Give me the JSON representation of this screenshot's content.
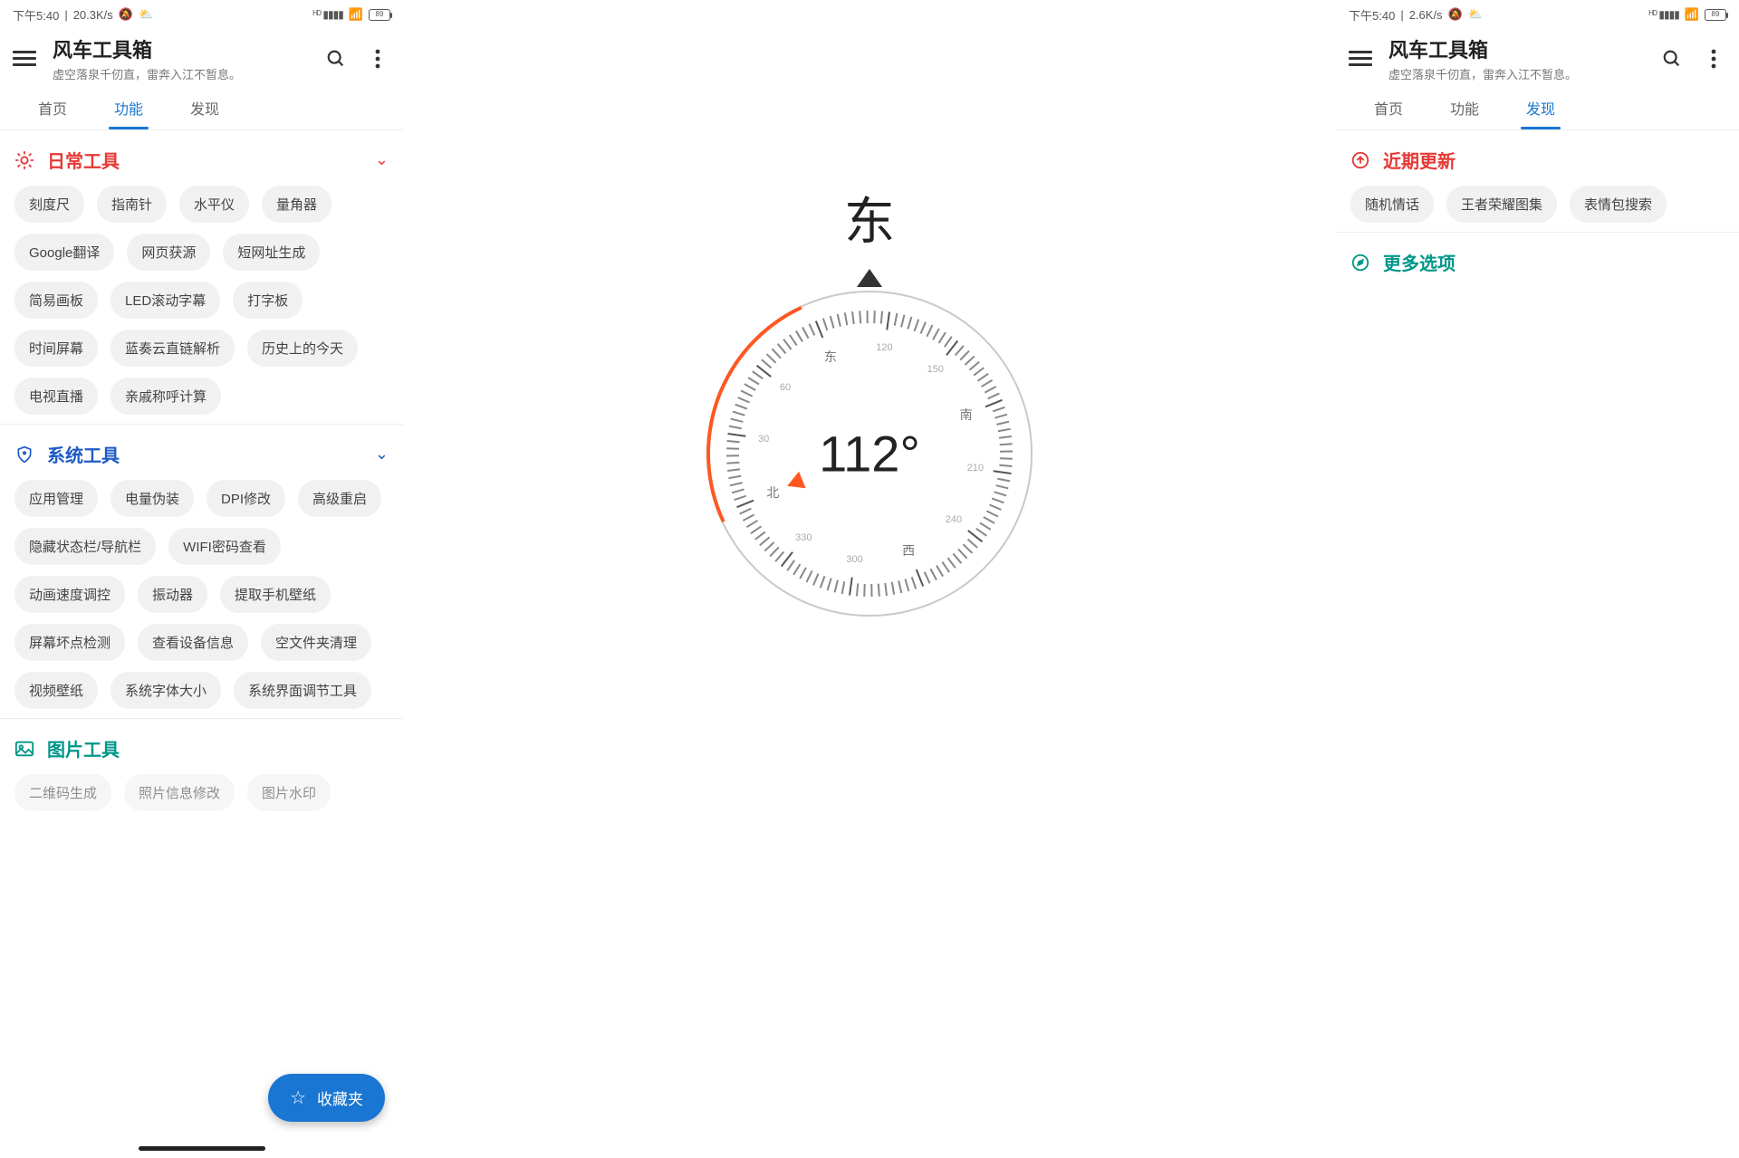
{
  "statusbar": {
    "time": "下午5:40",
    "net1": "20.3K/s",
    "net2": "2.6K/s",
    "battery": "89"
  },
  "app": {
    "title": "风车工具箱",
    "subtitle": "虚空落泉千仞直，雷奔入江不暂息。"
  },
  "tabs": {
    "home": "首页",
    "features": "功能",
    "discover": "发现"
  },
  "sections": {
    "daily": {
      "title": "日常工具",
      "items": [
        "刻度尺",
        "指南针",
        "水平仪",
        "量角器",
        "Google翻译",
        "网页获源",
        "短网址生成",
        "简易画板",
        "LED滚动字幕",
        "打字板",
        "时间屏幕",
        "蓝奏云直链解析",
        "历史上的今天",
        "电视直播",
        "亲戚称呼计算"
      ]
    },
    "system": {
      "title": "系统工具",
      "items": [
        "应用管理",
        "电量伪装",
        "DPI修改",
        "高级重启",
        "隐藏状态栏/导航栏",
        "WIFI密码查看",
        "动画速度调控",
        "振动器",
        "提取手机壁纸",
        "屏幕坏点检测",
        "查看设备信息",
        "空文件夹清理",
        "视频壁纸",
        "系统字体大小",
        "系统界面调节工具"
      ]
    },
    "image": {
      "title": "图片工具",
      "items": [
        "二维码生成",
        "照片信息修改",
        "图片水印"
      ]
    },
    "updates": {
      "title": "近期更新",
      "items": [
        "随机情话",
        "王者荣耀图集",
        "表情包搜索"
      ]
    },
    "more": {
      "title": "更多选项"
    }
  },
  "fab": {
    "label": "收藏夹"
  },
  "compass": {
    "direction": "东",
    "degrees": "112°",
    "cardinals": {
      "e": "东",
      "s": "南",
      "w": "西",
      "n": "北"
    }
  }
}
